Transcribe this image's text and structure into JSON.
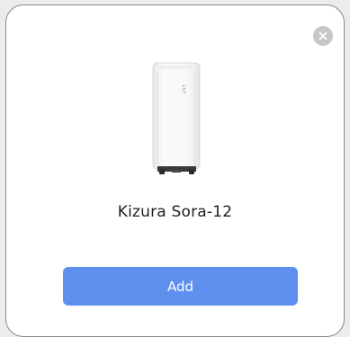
{
  "dialog": {
    "device_name": "Kizura Sora-12",
    "add_label": "Add",
    "product_image_icon": "portable-air-conditioner-icon",
    "close_icon": "close-icon"
  },
  "colors": {
    "primary_button": "#5e8fee",
    "close_button": "#c7c7c7",
    "text": "#1f1f1f"
  }
}
